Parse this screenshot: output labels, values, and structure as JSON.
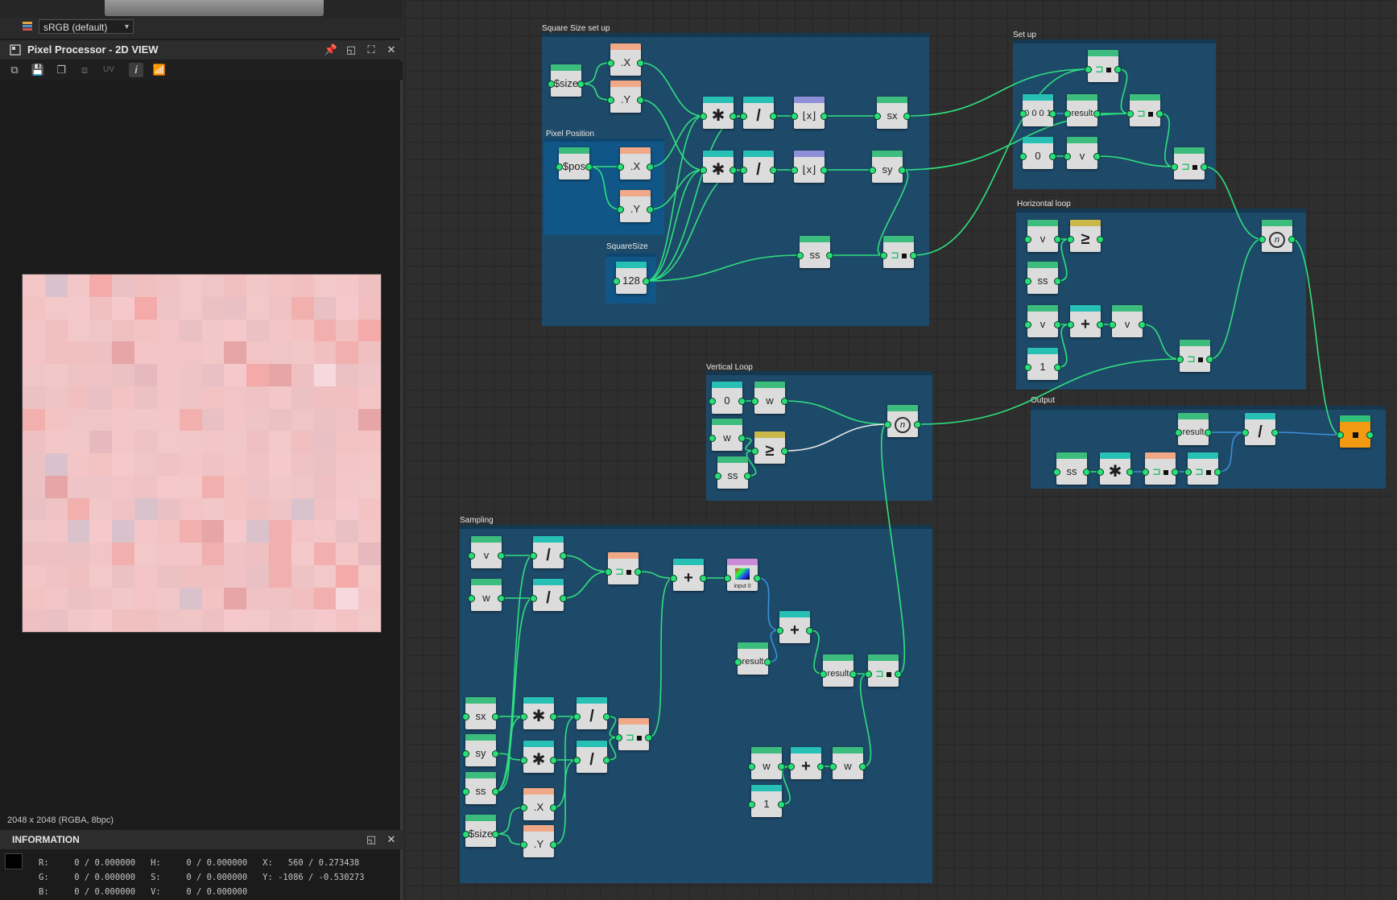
{
  "left_panel": {
    "colorspace": "sRGB (default)",
    "title": "Pixel Processor - 2D VIEW",
    "toolbar": {
      "uv_label": "UV"
    },
    "preview_colors": [
      "#f2c7c8",
      "#efc2c3",
      "#f0c5c6",
      "#f3c8c9",
      "#eec0c1",
      "#f5c9cb",
      "#ecc1c4",
      "#f1bfc0",
      "#f3c6c8",
      "#efc3c5",
      "#e9c0c3",
      "#f4c5c6",
      "#f0c0c1",
      "#f2c4c5",
      "#efc4c6",
      "#f3c2c3"
    ],
    "image_info": "2048 x 2048 (RGBA, 8bpc)",
    "info": {
      "title": "INFORMATION",
      "row1": "R:     0 / 0.000000   H:     0 / 0.000000   X:   560 / 0.273438",
      "row2": "G:     0 / 0.000000   S:     0 / 0.000000   Y: -1086 / -0.530273",
      "row3": "B:     0 / 0.000000   V:     0 / 0.000000"
    }
  },
  "frames": {
    "square_size": "Square Size set up",
    "pixel_position": "Pixel Position",
    "square_size_sub": "SquareSize",
    "setup": "Set up",
    "horizontal": "Horizontal loop",
    "vertical": "Vertical Loop",
    "output": "Output",
    "sampling": "Sampling"
  },
  "nodes": {
    "size1": "$size",
    "sx_comp": ".X",
    "sy_comp": ".Y",
    "mul1": "✱",
    "mul2": "✱",
    "div1": "/",
    "div2": "/",
    "fl1": "⌊x⌋",
    "fl2": "⌊x⌋",
    "set_sx": "sx",
    "set_sy": "sy",
    "pos": "$pos",
    "px": ".X",
    "py": ".Y",
    "val128": "128",
    "set_ss": "ss",
    "su_vec": "0 0 0 1",
    "su_result": "result",
    "su_zero": "0",
    "su_v": "v",
    "h_v1": "v",
    "h_ge": "≥",
    "h_ss": "ss",
    "h_v2": "v",
    "h_add": "+",
    "h_v3": "v",
    "h_one": "1",
    "v_zero": "0",
    "v_w1": "w",
    "v_w2": "w",
    "v_ge": "≥",
    "v_ss": "ss",
    "o_result": "result",
    "o_div": "/",
    "o_ss": "ss",
    "o_mul": "✱",
    "s_v": "v",
    "s_w": "w",
    "s_div1": "/",
    "s_div2": "/",
    "s_add1": "+",
    "s_input": "input 0",
    "s_add2": "+",
    "s_result1": "result",
    "s_result2": "result",
    "s_sx": "sx",
    "s_sy": "sy",
    "s_ss": "ss",
    "s_size": "$size",
    "s_mul1": "✱",
    "s_mul2": "✱",
    "s_div3": "/",
    "s_div4": "/",
    "s_x": ".X",
    "s_y": ".Y",
    "s_w2": "w",
    "s_add3": "+",
    "s_w3": "w",
    "s_one": "1"
  }
}
